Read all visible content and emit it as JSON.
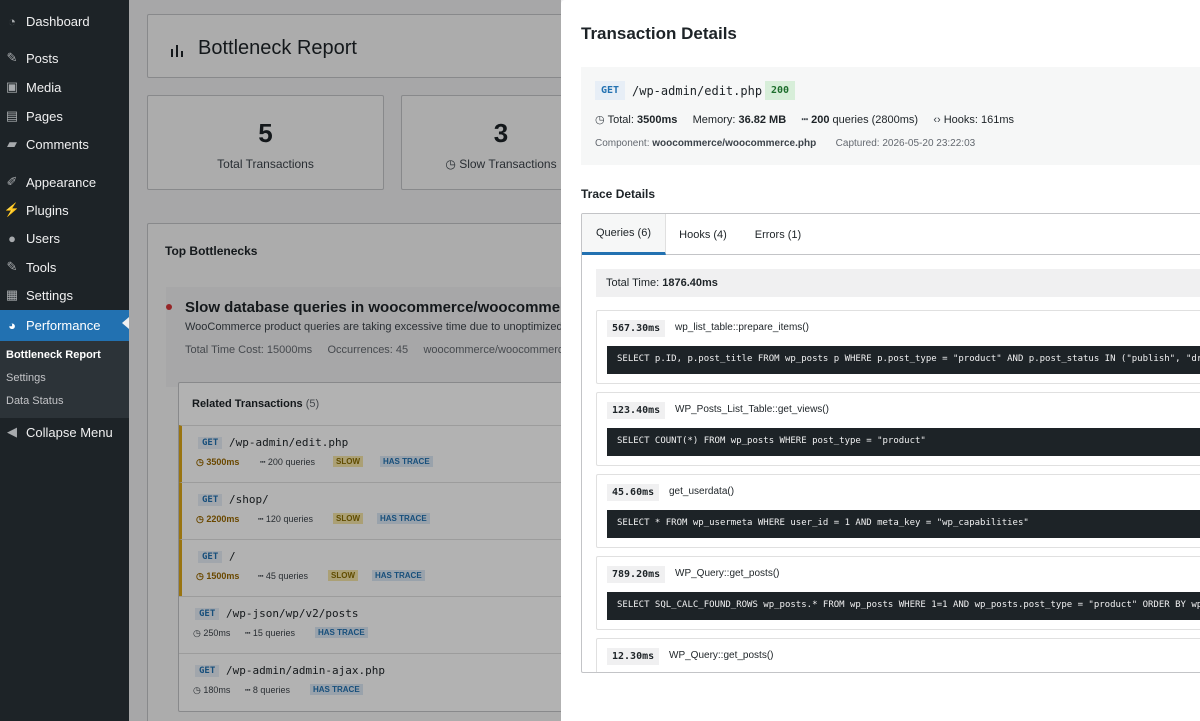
{
  "sidebar": {
    "items": [
      {
        "label": "Dashboard",
        "icon": "dashboard-icon",
        "glyph": "◔"
      },
      {
        "label": "Posts",
        "icon": "pin-icon",
        "glyph": "✎"
      },
      {
        "label": "Media",
        "icon": "media-icon",
        "glyph": "▣"
      },
      {
        "label": "Pages",
        "icon": "pages-icon",
        "glyph": "▤"
      },
      {
        "label": "Comments",
        "icon": "comment-icon",
        "glyph": "▰"
      },
      {
        "label": "Appearance",
        "icon": "brush-icon",
        "glyph": "✐"
      },
      {
        "label": "Plugins",
        "icon": "plugin-icon",
        "glyph": "⚡"
      },
      {
        "label": "Users",
        "icon": "user-icon",
        "glyph": "●"
      },
      {
        "label": "Tools",
        "icon": "wrench-icon",
        "glyph": "✎"
      },
      {
        "label": "Settings",
        "icon": "settings-icon",
        "glyph": "▦"
      },
      {
        "label": "Performance",
        "icon": "performance-icon",
        "glyph": "◕"
      }
    ],
    "submenu": [
      "Bottleneck Report",
      "Settings",
      "Data Status"
    ],
    "collapse_label": "Collapse Menu",
    "collapse_glyph": "◀"
  },
  "report": {
    "title": "Bottleneck Report",
    "stats": [
      {
        "value": "5",
        "label": "Total Transactions"
      },
      {
        "value": "3",
        "label": "Slow Transactions"
      }
    ],
    "top_bottlenecks": {
      "title": "Top Bottlenecks",
      "item": {
        "title": "Slow database queries in woocommerce/woocommerce.php",
        "description": "WooCommerce product queries are taking excessive time due to unoptimized meta queries",
        "total_time": "Total Time Cost: 15000ms",
        "occurrences": "Occurrences: 45",
        "component": "woocommerce/woocommerce.php"
      },
      "related": {
        "title": "Related Transactions",
        "count": "(5)",
        "rows": [
          {
            "method": "GET",
            "path": "/wp-admin/edit.php",
            "time": "3500ms",
            "queries": "200 queries",
            "slow": "SLOW",
            "trace": "HAS TRACE",
            "is_slow": true
          },
          {
            "method": "GET",
            "path": "/shop/",
            "time": "2200ms",
            "queries": "120 queries",
            "slow": "SLOW",
            "trace": "HAS TRACE",
            "is_slow": true
          },
          {
            "method": "GET",
            "path": "/",
            "time": "1500ms",
            "queries": "45 queries",
            "slow": "SLOW",
            "trace": "HAS TRACE",
            "is_slow": true
          },
          {
            "method": "GET",
            "path": "/wp-json/wp/v2/posts",
            "time": "250ms",
            "queries": "15 queries",
            "slow": "",
            "trace": "HAS TRACE",
            "is_slow": false
          },
          {
            "method": "GET",
            "path": "/wp-admin/admin-ajax.php",
            "time": "180ms",
            "queries": "8 queries",
            "slow": "",
            "trace": "HAS TRACE",
            "is_slow": false
          }
        ]
      }
    }
  },
  "modal": {
    "title": "Transaction Details",
    "method": "GET",
    "url": "/wp-admin/edit.php",
    "status": "200",
    "total_label": "Total:",
    "total": "3500ms",
    "memory_label": "Memory:",
    "memory": "36.82 MB",
    "queries": "200",
    "queries_label": "queries (2800ms)",
    "hooks": "Hooks: 161ms",
    "component_label": "Component:",
    "component": "woocommerce/woocommerce.php",
    "captured": "Captured: 2026-05-20 23:22:03",
    "trace_title": "Trace Details",
    "tabs": [
      "Queries (6)",
      "Hooks (4)",
      "Errors (1)"
    ],
    "total_time_label": "Total Time:",
    "total_time": "1876.40ms",
    "queries_list": [
      {
        "duration": "567.30ms",
        "function": "wp_list_table::prepare_items()",
        "sql": "SELECT p.ID, p.post_title FROM wp_posts p WHERE p.post_type = \"product\" AND p.post_status IN (\"publish\", \"draft\")"
      },
      {
        "duration": "123.40ms",
        "function": "WP_Posts_List_Table::get_views()",
        "sql": "SELECT COUNT(*) FROM wp_posts WHERE post_type = \"product\""
      },
      {
        "duration": "45.60ms",
        "function": "get_userdata()",
        "sql": "SELECT * FROM wp_usermeta WHERE user_id = 1 AND meta_key = \"wp_capabilities\""
      },
      {
        "duration": "789.20ms",
        "function": "WP_Query::get_posts()",
        "sql": "SELECT SQL_CALC_FOUND_ROWS wp_posts.* FROM wp_posts WHERE 1=1 AND wp_posts.post_type = \"product\" ORDER BY wp_posts.post_date DESC"
      },
      {
        "duration": "12.30ms",
        "function": "WP_Query::get_posts()",
        "sql": ""
      }
    ]
  },
  "colors": {
    "accent": "#2271b1",
    "sidebar": "#1d2327",
    "slow": "#dba617",
    "danger": "#d63638",
    "success": "#1e6e2d"
  }
}
